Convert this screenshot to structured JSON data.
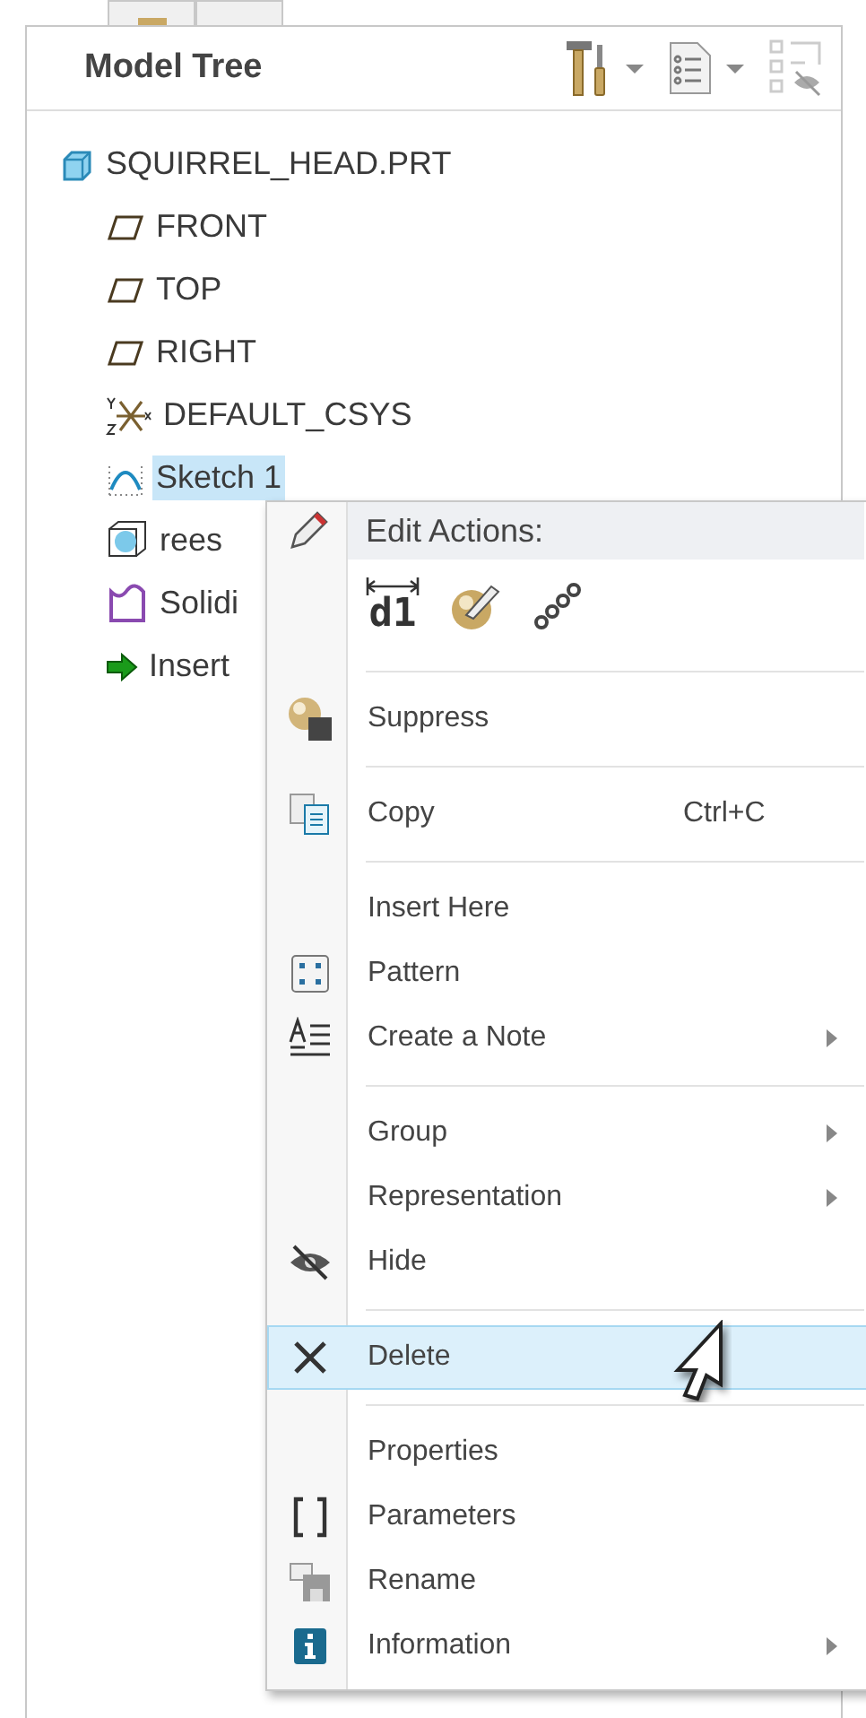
{
  "header": {
    "title": "Model Tree"
  },
  "tree": {
    "label": "SQUIRREL_HEAD.PRT",
    "kind": "part",
    "children": [
      {
        "label": "FRONT",
        "kind": "plane",
        "selected": false
      },
      {
        "label": "TOP",
        "kind": "plane",
        "selected": false
      },
      {
        "label": "RIGHT",
        "kind": "plane",
        "selected": false
      },
      {
        "label": "DEFAULT_CSYS",
        "kind": "csys",
        "selected": false
      },
      {
        "label": "Sketch 1",
        "kind": "sketch",
        "selected": true
      },
      {
        "label": "rees",
        "kind": "feature",
        "selected": false
      },
      {
        "label": "Solidi",
        "kind": "solidify",
        "selected": false
      },
      {
        "label": "Insert",
        "kind": "insert",
        "selected": false
      }
    ]
  },
  "menu": {
    "header": "Edit Actions:",
    "actions": [
      {
        "kind": "dimension",
        "text": "d1"
      },
      {
        "kind": "edit-definition"
      },
      {
        "kind": "references"
      }
    ],
    "items": [
      {
        "kind": "separator"
      },
      {
        "kind": "suppress",
        "label": "Suppress",
        "selected": false
      },
      {
        "kind": "separator"
      },
      {
        "kind": "copy",
        "label": "Copy",
        "shortcut": "Ctrl+C",
        "selected": false
      },
      {
        "kind": "separator"
      },
      {
        "kind": "plain",
        "label": "Insert Here",
        "selected": false
      },
      {
        "kind": "pattern",
        "label": "Pattern",
        "selected": false
      },
      {
        "kind": "note",
        "label": "Create a Note",
        "submenu": true,
        "selected": false
      },
      {
        "kind": "separator"
      },
      {
        "kind": "plain",
        "label": "Group",
        "submenu": true,
        "selected": false
      },
      {
        "kind": "plain",
        "label": "Representation",
        "submenu": true,
        "selected": false
      },
      {
        "kind": "hide",
        "label": "Hide",
        "selected": false
      },
      {
        "kind": "separator"
      },
      {
        "kind": "delete",
        "label": "Delete",
        "selected": true
      },
      {
        "kind": "separator"
      },
      {
        "kind": "plain",
        "label": "Properties",
        "selected": false
      },
      {
        "kind": "parameters",
        "label": "Parameters",
        "selected": false
      },
      {
        "kind": "rename",
        "label": "Rename",
        "selected": false
      },
      {
        "kind": "info",
        "label": "Information",
        "submenu": true,
        "selected": false
      }
    ]
  }
}
